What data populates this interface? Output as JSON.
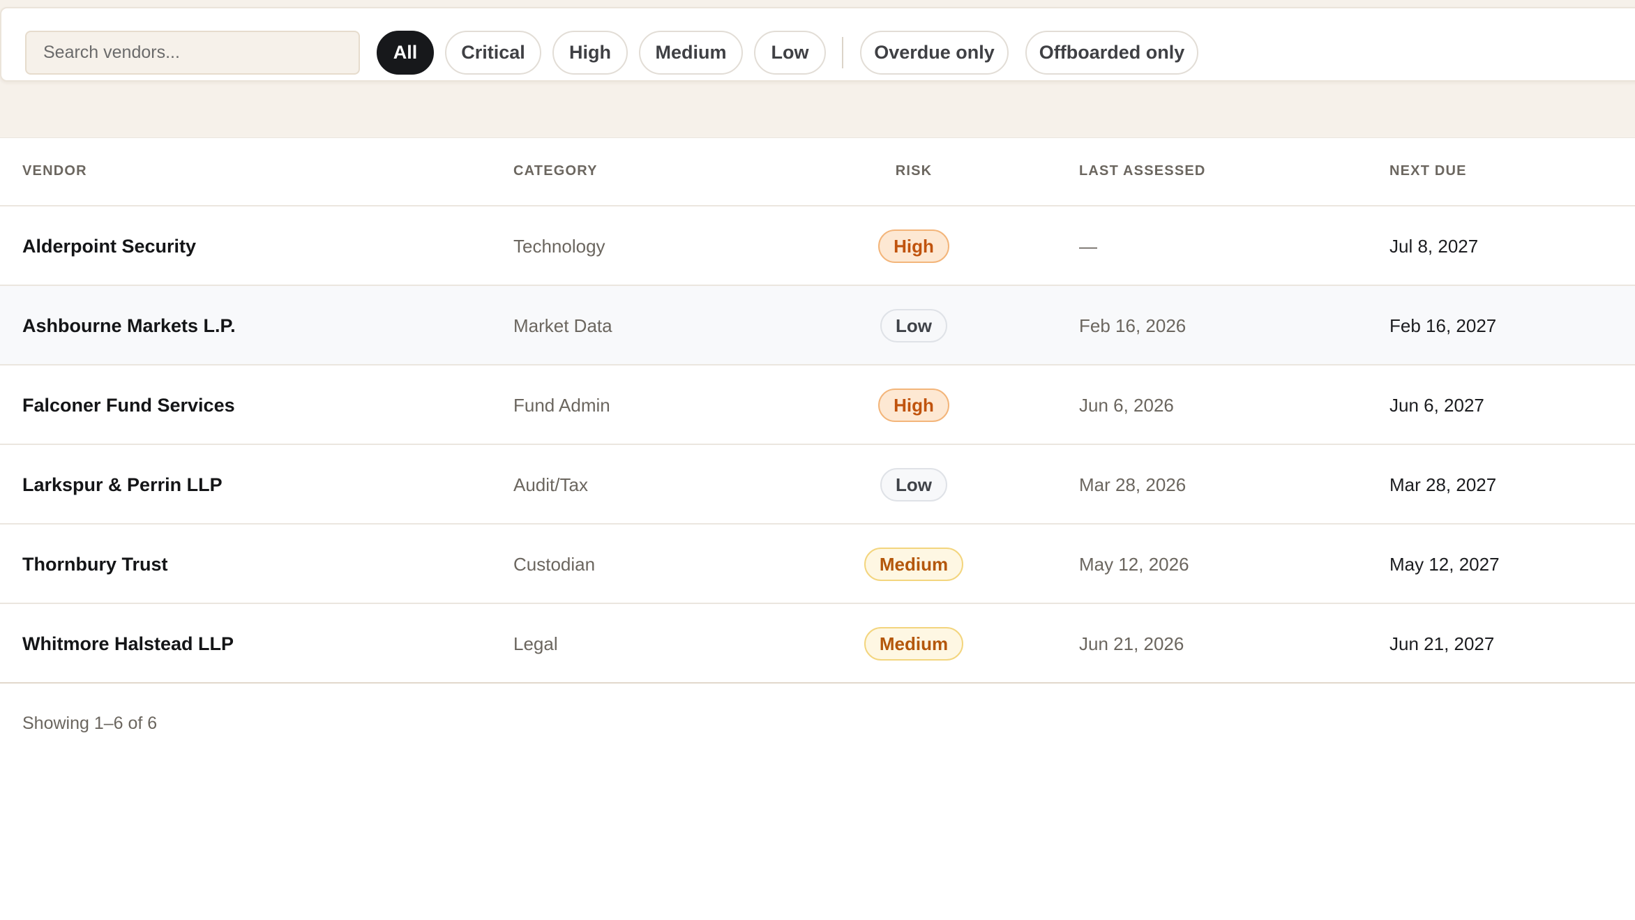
{
  "search": {
    "placeholder": "Search vendors..."
  },
  "filters": {
    "risk_chips": [
      "All",
      "Critical",
      "High",
      "Medium",
      "Low"
    ],
    "active": "All",
    "toggle_chips": [
      "Overdue only",
      "Offboarded only"
    ]
  },
  "table": {
    "headers": {
      "vendor": "VENDOR",
      "category": "CATEGORY",
      "risk": "RISK",
      "last_assessed": "LAST ASSESSED",
      "next_due": "NEXT DUE"
    },
    "rows": [
      {
        "vendor": "Alderpoint Security",
        "category": "Technology",
        "risk": "High",
        "last_assessed": "—",
        "next_due": "Jul 8, 2027"
      },
      {
        "vendor": "Ashbourne Markets L.P.",
        "category": "Market Data",
        "risk": "Low",
        "last_assessed": "Feb 16, 2026",
        "next_due": "Feb 16, 2027"
      },
      {
        "vendor": "Falconer Fund Services",
        "category": "Fund Admin",
        "risk": "High",
        "last_assessed": "Jun 6, 2026",
        "next_due": "Jun 6, 2027"
      },
      {
        "vendor": "Larkspur & Perrin LLP",
        "category": "Audit/Tax",
        "risk": "Low",
        "last_assessed": "Mar 28, 2026",
        "next_due": "Mar 28, 2027"
      },
      {
        "vendor": "Thornbury Trust",
        "category": "Custodian",
        "risk": "Medium",
        "last_assessed": "May 12, 2026",
        "next_due": "May 12, 2027"
      },
      {
        "vendor": "Whitmore Halstead LLP",
        "category": "Legal",
        "risk": "Medium",
        "last_assessed": "Jun 21, 2026",
        "next_due": "Jun 21, 2027"
      }
    ]
  },
  "footer": {
    "count_text": "Showing 1–6 of 6"
  },
  "colors": {
    "active_chip": "#17181b",
    "page_band": "#f6f1ea",
    "risk_high": "#c0530d",
    "risk_medium": "#b4570b",
    "risk_low": "#3f4248"
  }
}
